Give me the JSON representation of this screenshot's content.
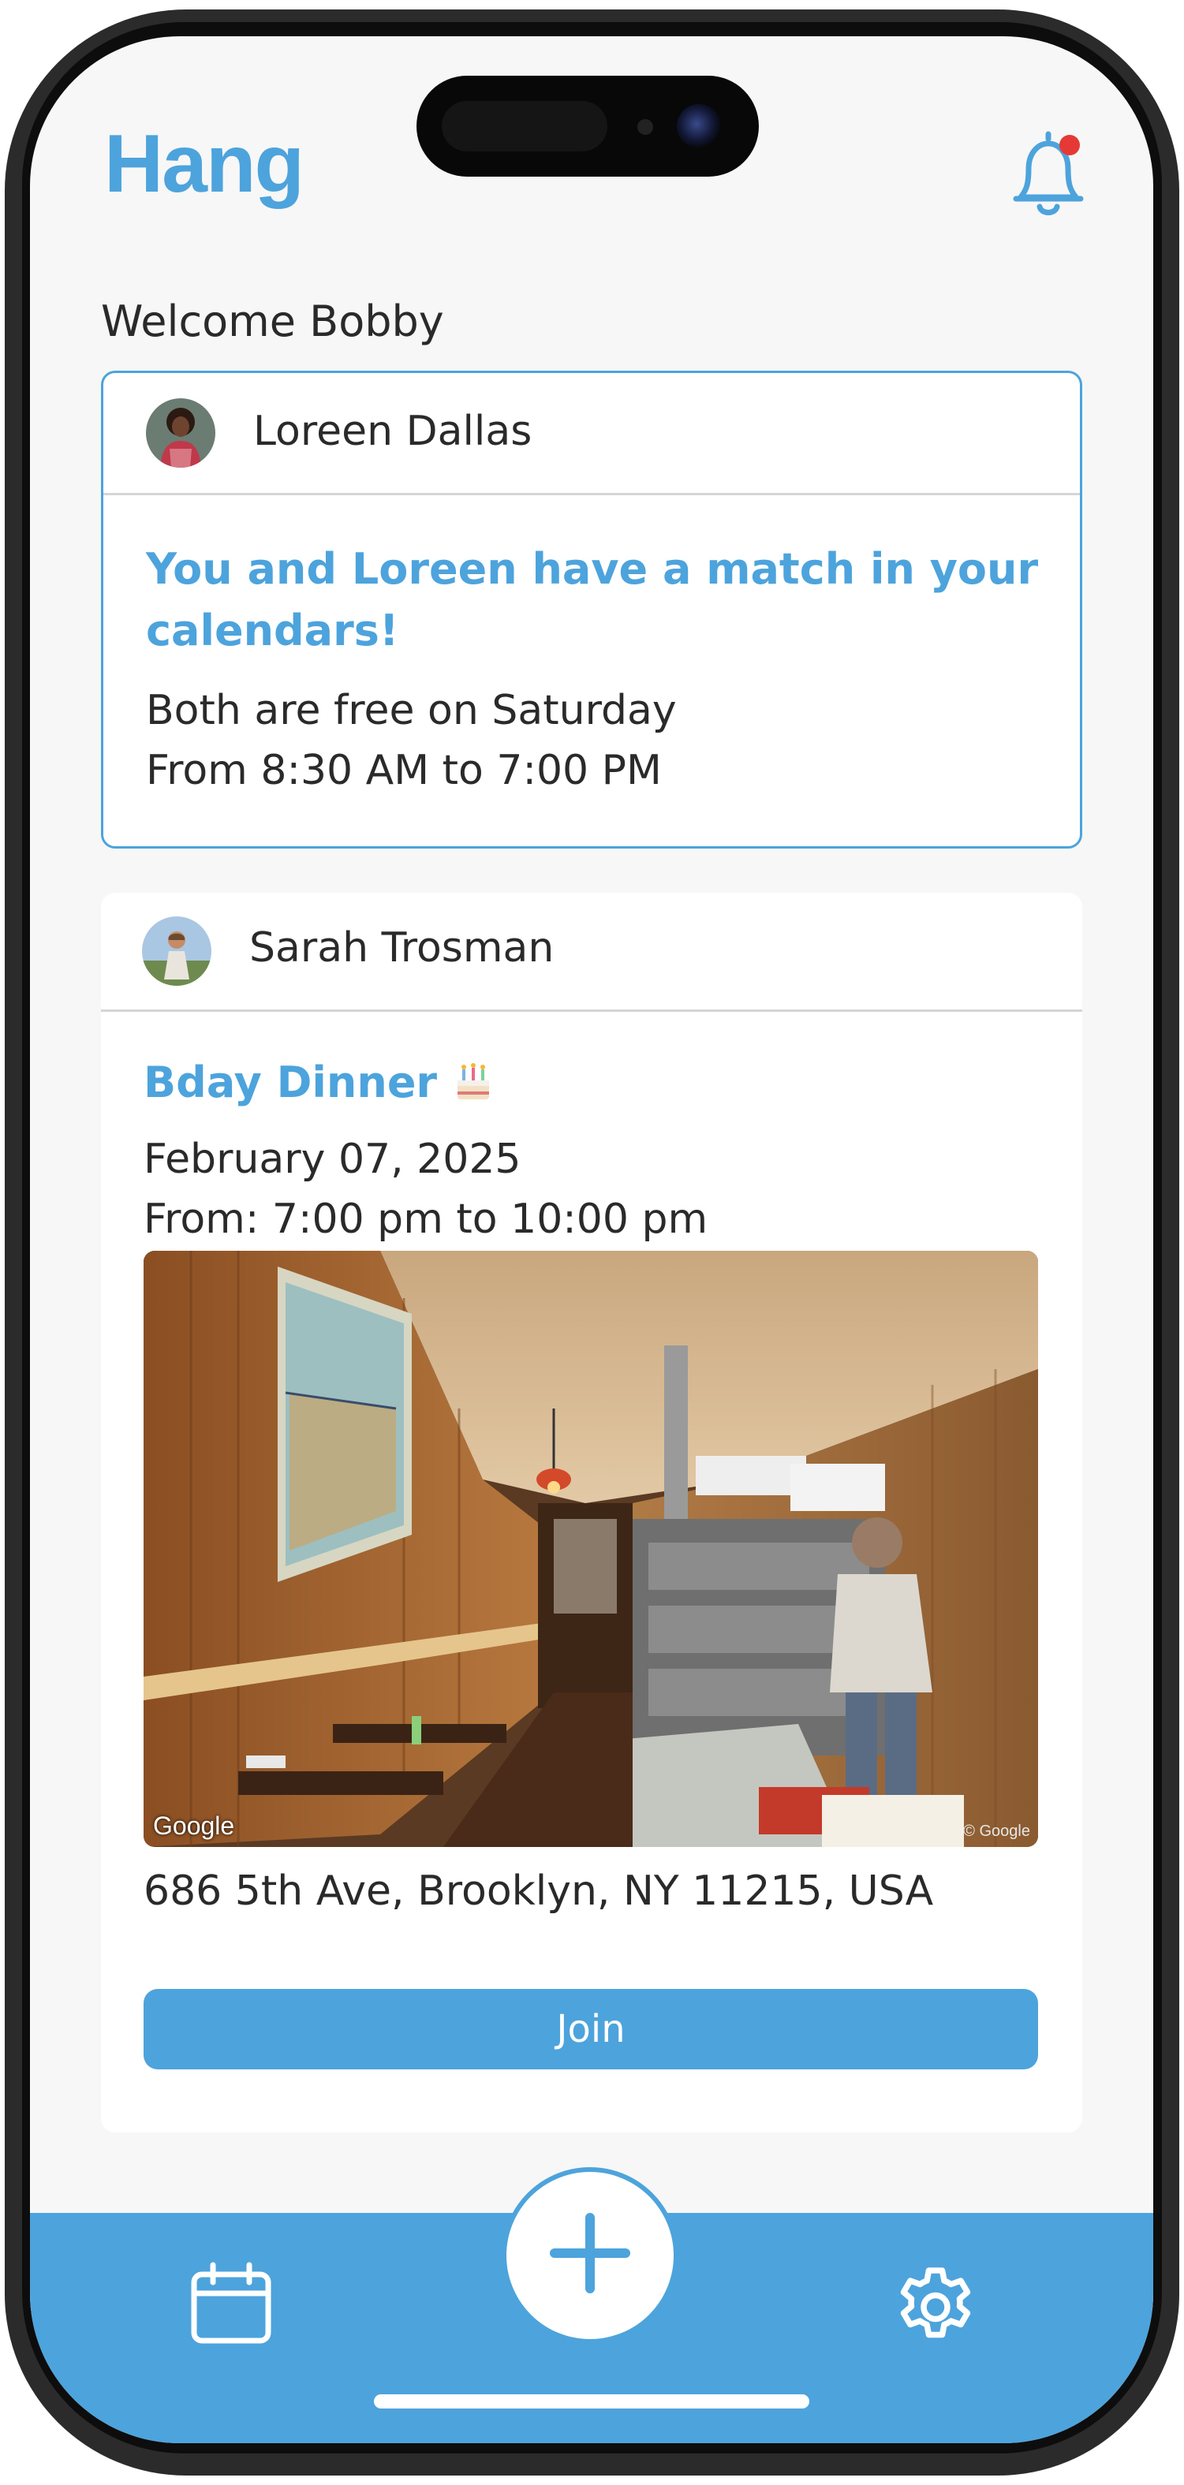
{
  "app": {
    "title": "Hang",
    "accent_color": "#4da3dc",
    "notification_dot_color": "#e53935"
  },
  "header": {
    "welcome": "Welcome Bobby",
    "bell_icon": "bell-icon"
  },
  "match_card": {
    "user_name": "Loreen Dallas",
    "title": "You and Loreen have a match in your calendars!",
    "line1": "Both are free on Saturday",
    "line2": "From 8:30 AM to 7:00 PM"
  },
  "event_card": {
    "user_name": "Sarah Trosman",
    "title": "Bday Dinner",
    "title_emoji_icon": "birthday-cake-icon",
    "date": "February 07, 2025",
    "time": "From: 7:00 pm to 10:00 pm",
    "photo_credit": "Google",
    "photo_copyright": "© Google",
    "address": "686 5th Ave, Brooklyn, NY 11215, USA",
    "join_label": "Join"
  },
  "tab_bar": {
    "left_icon": "calendar-icon",
    "center_icon": "plus-icon",
    "right_icon": "gear-icon"
  }
}
